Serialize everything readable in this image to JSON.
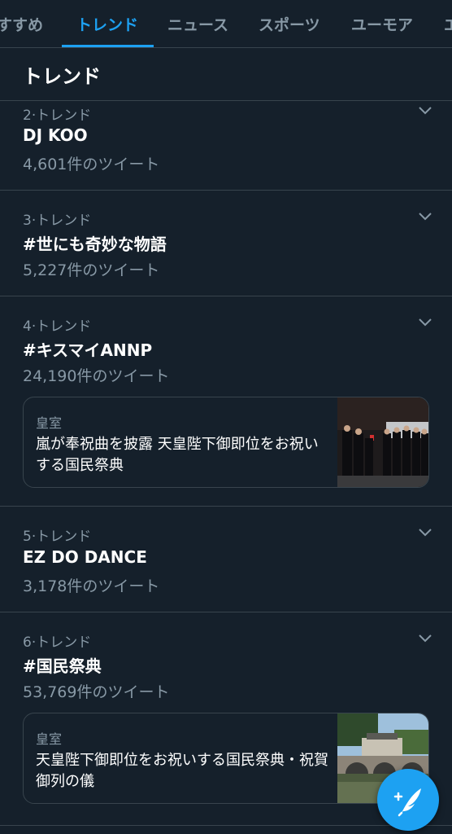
{
  "tabs": [
    {
      "label": "すすめ"
    },
    {
      "label": "トレンド"
    },
    {
      "label": "ニュース"
    },
    {
      "label": "スポーツ"
    },
    {
      "label": "ユーモア"
    },
    {
      "label": "エ"
    }
  ],
  "active_tab": "トレンド",
  "section_title": "トレンド",
  "trends": [
    {
      "meta": "2·トレンド",
      "name": "DJ KOO",
      "count": "4,601件のツイート"
    },
    {
      "meta": "3·トレンド",
      "name": "#世にも奇妙な物語",
      "count": "5,227件のツイート"
    },
    {
      "meta": "4·トレンド",
      "name": "#キスマイANNP",
      "count": "24,190件のツイート",
      "news": {
        "category": "皇室",
        "headline": "嵐が奉祝曲を披露 天皇陛下御即位をお祝いする国民祭典"
      }
    },
    {
      "meta": "5·トレンド",
      "name": "EZ DO DANCE",
      "count": "3,178件のツイート"
    },
    {
      "meta": "6·トレンド",
      "name": "#国民祭典",
      "count": "53,769件のツイート",
      "news": {
        "category": "皇室",
        "headline": "天皇陛下御即位をお祝いする国民祭典・祝賀御列の儀"
      }
    }
  ],
  "colors": {
    "background": "#15202b",
    "accent": "#1da1f2",
    "secondary_text": "#8899a6",
    "divider": "#38444d"
  },
  "icons": {
    "more": "chevron-down-icon",
    "compose": "compose-tweet-icon"
  }
}
